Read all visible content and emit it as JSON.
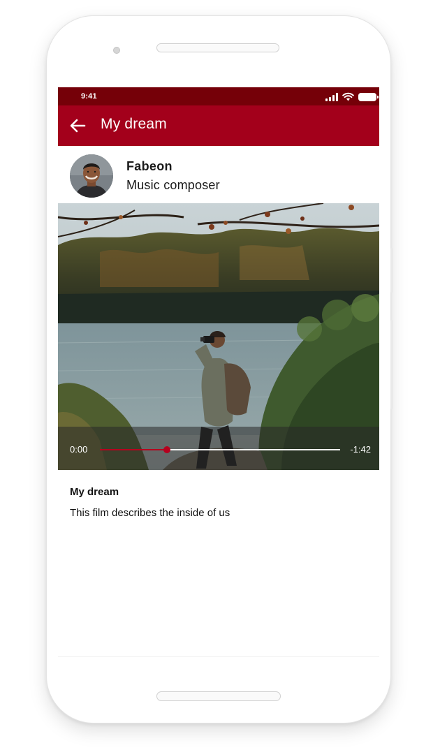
{
  "status_bar": {
    "time": "9:41",
    "icons": [
      "signal-icon",
      "wifi-icon",
      "battery-icon"
    ]
  },
  "app_bar": {
    "back_icon": "back-arrow-icon",
    "title": "My dream"
  },
  "profile": {
    "name": "Fabeon",
    "role": "Music composer"
  },
  "video": {
    "current_time": "0:00",
    "remaining_time": "-1:42",
    "progress": 0.28
  },
  "description": {
    "title": "My dream",
    "text": "This film describes the inside of us"
  },
  "colors": {
    "status_bar": "#750008",
    "app_bar": "#a3001b",
    "accent": "#b5001e"
  }
}
